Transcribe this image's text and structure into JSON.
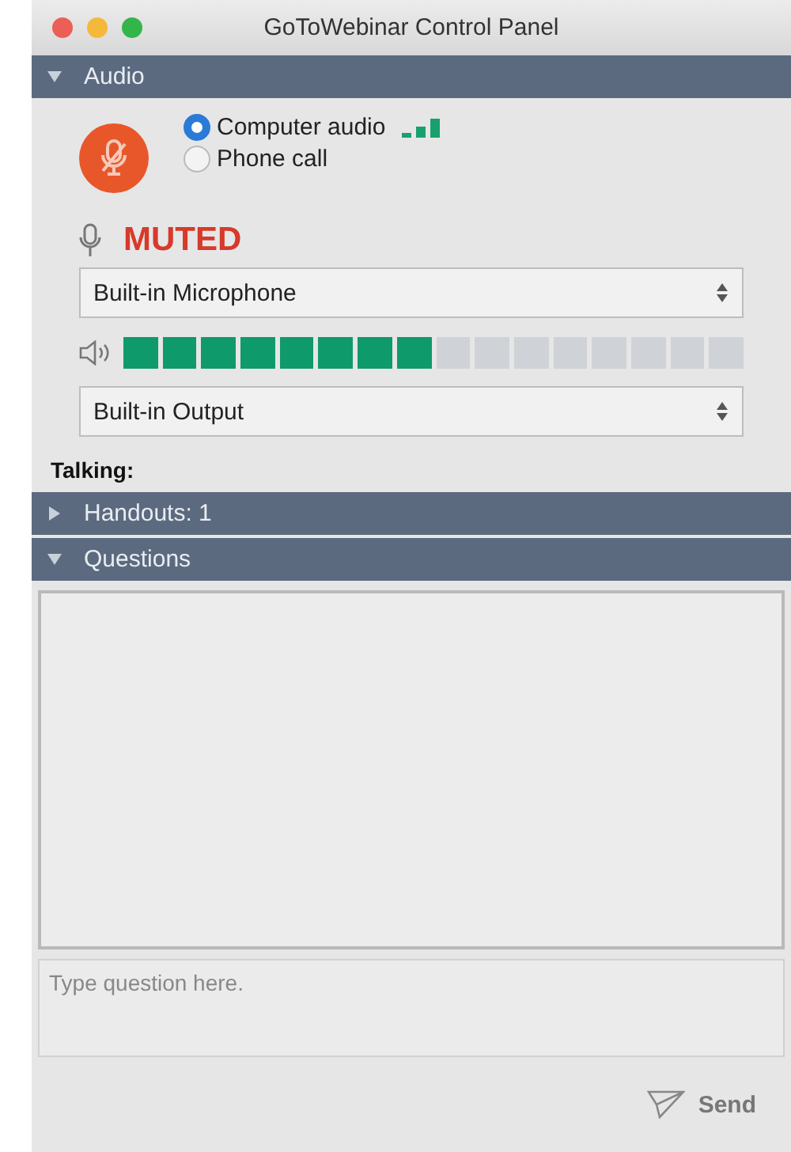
{
  "window": {
    "title": "GoToWebinar Control Panel"
  },
  "sections": [
    {
      "kind": "audio",
      "title": "Audio",
      "expanded": true
    },
    {
      "kind": "handouts",
      "title": "Handouts: 1",
      "expanded": false
    },
    {
      "kind": "questions",
      "title": "Questions",
      "expanded": true
    }
  ],
  "audio": {
    "muted": true,
    "status": "MUTED",
    "options": [
      {
        "label": "Computer audio",
        "selected": true
      },
      {
        "label": "Phone call",
        "selected": false
      }
    ],
    "microphone": "Built-in Microphone",
    "speaker_meter": {
      "level": 0.5
    },
    "speaker": "Built-in Output",
    "talking_label": "Talking:"
  },
  "questions": {
    "placeholder": "Type question here.",
    "send": "Send"
  }
}
